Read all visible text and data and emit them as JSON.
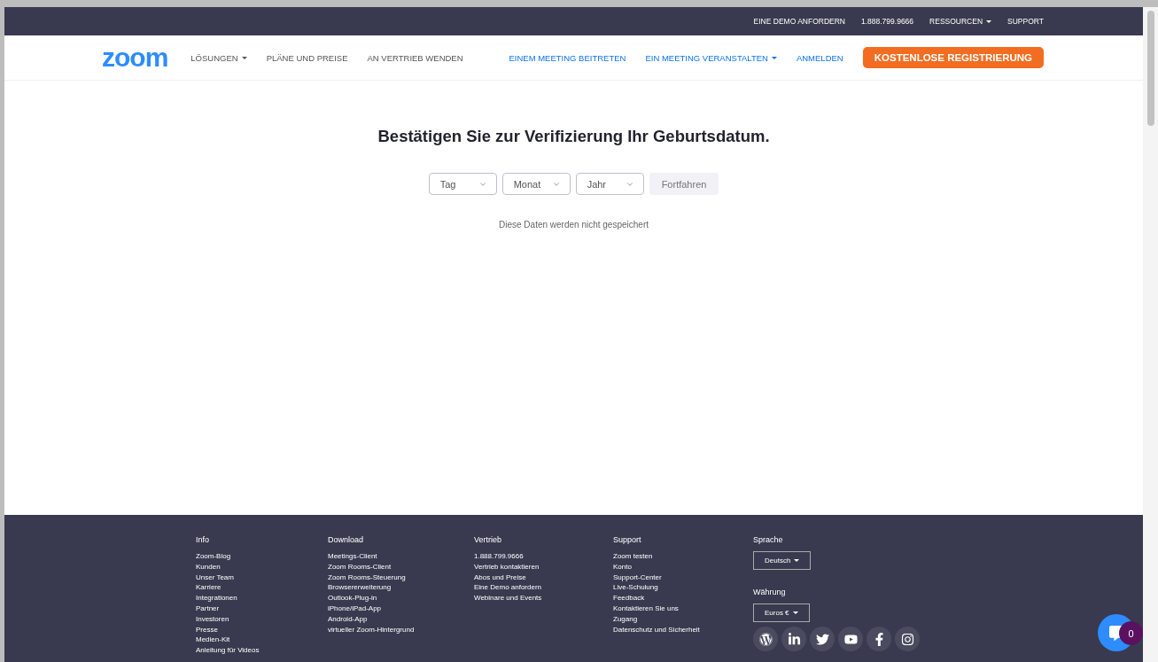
{
  "top_bar": {
    "links": [
      {
        "label": "EINE DEMO ANFORDERN",
        "dropdown": false
      },
      {
        "label": "1.888.799.9666",
        "dropdown": false
      },
      {
        "label": "RESSOURCEN",
        "dropdown": true
      },
      {
        "label": "SUPPORT",
        "dropdown": false
      }
    ]
  },
  "nav": {
    "logo": "zoom",
    "left_links": [
      {
        "label": "LÖSUNGEN",
        "dropdown": true
      },
      {
        "label": "PLÄNE UND PREISE",
        "dropdown": false
      },
      {
        "label": "AN VERTRIEB WENDEN",
        "dropdown": false
      }
    ],
    "right_links": [
      {
        "label": "EINEM MEETING BEITRETEN",
        "dropdown": false
      },
      {
        "label": "EIN MEETING VERANSTALTEN",
        "dropdown": true
      },
      {
        "label": "ANMELDEN",
        "dropdown": false
      }
    ],
    "cta": "KOSTENLOSE REGISTRIERUNG"
  },
  "main": {
    "title": "Bestätigen Sie zur Verifizierung Ihr Geburtsdatum.",
    "selects": [
      {
        "placeholder": "Tag"
      },
      {
        "placeholder": "Monat"
      },
      {
        "placeholder": "Jahr"
      }
    ],
    "continue_button": {
      "label": "Fortfahren",
      "disabled": true
    },
    "note": "Diese Daten werden nicht gespeichert"
  },
  "footer": {
    "columns": [
      {
        "title": "Info",
        "links": [
          "Zoom-Blog",
          "Kunden",
          "Unser Team",
          "Karriere",
          "Integrationen",
          "Partner",
          "Investoren",
          "Presse",
          "Medien-Kit",
          "Anleitung für Videos"
        ]
      },
      {
        "title": "Download",
        "links": [
          "Meetings-Client",
          "Zoom Rooms-Client",
          "Zoom Rooms-Steuerung",
          "Browsererweiterung",
          "Outlook-Plug-in",
          "iPhone/iPad-App",
          "Android-App",
          "virtueller Zoom-Hintergrund"
        ]
      },
      {
        "title": "Vertrieb",
        "links": [
          "1.888.799.9666",
          "Vertrieb kontaktieren",
          "Abos und Preise",
          "Eine Demo anfordern",
          "Webinare und Events"
        ]
      },
      {
        "title": "Support",
        "links": [
          "Zoom testen",
          "Konto",
          "Support-Center",
          "Live-Schulung",
          "Feedback",
          "Kontaktieren Sie uns",
          "Zugang",
          "Datenschutz und Sicherheit"
        ]
      }
    ],
    "language": {
      "title": "Sprache",
      "value": "Deutsch"
    },
    "currency": {
      "title": "Währung",
      "value": "Euros €"
    },
    "social": [
      {
        "kind": "wordpress"
      },
      {
        "kind": "linkedin"
      },
      {
        "kind": "twitter"
      },
      {
        "kind": "youtube"
      },
      {
        "kind": "facebook"
      },
      {
        "kind": "instagram"
      }
    ]
  },
  "chat": {
    "count": "0"
  }
}
